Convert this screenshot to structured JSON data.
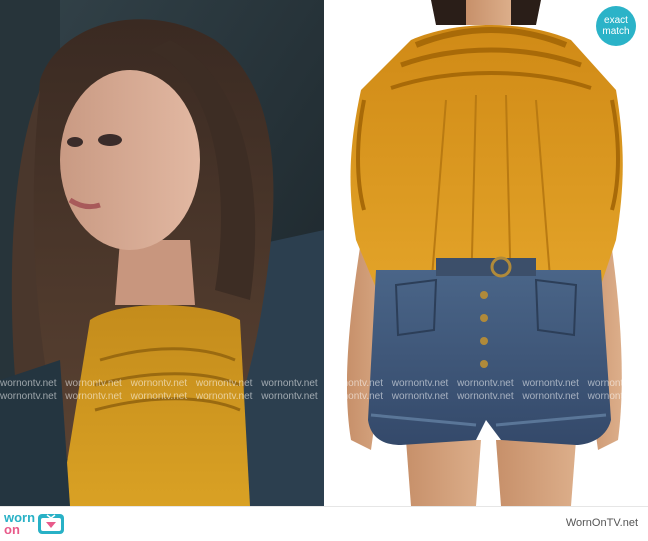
{
  "left_image": {
    "alt": ""
  },
  "right_image": {
    "alt": ""
  },
  "badge": {
    "line1": "exact",
    "line2": "match"
  },
  "watermark": {
    "items_row_1": [
      "wornontv.net",
      "wornontv.net",
      "wornontv.net",
      "wornontv.net",
      "wornontv.net",
      "wornontv.net",
      "wornontv.net",
      "wornontv.net",
      "wornontv.net",
      "wornontv.net"
    ],
    "items_row_2": [
      "wornontv.net",
      "wornontv.net",
      "wornontv.net",
      "wornontv.net",
      "wornontv.net",
      "wornontv.net",
      "wornontv.net",
      "wornontv.net",
      "wornontv.net",
      "wornontv.net"
    ]
  },
  "footer": {
    "logo_line1": "worn",
    "logo_line2": "on",
    "logo_line3": "tv",
    "site": "WornOnTV.net"
  },
  "colors": {
    "accent": "#28b1c6",
    "logo_on": "#e85a8a",
    "blouse": "#d7941c",
    "denim": "#3e5879",
    "coat": "#2c3f4f"
  },
  "icons": [
    "tv-icon"
  ]
}
